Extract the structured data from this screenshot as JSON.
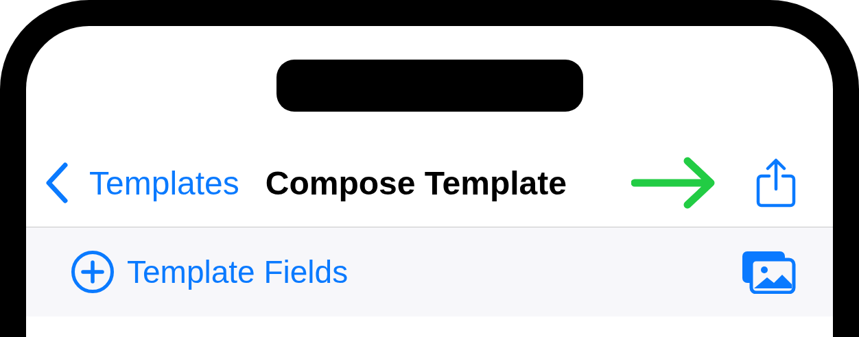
{
  "nav_bar": {
    "back_label": "Templates",
    "title": "Compose Template"
  },
  "toolbar": {
    "add_label": "Template Fields"
  }
}
